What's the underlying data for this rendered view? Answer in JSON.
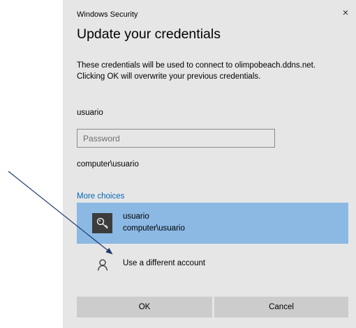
{
  "window": {
    "title": "Windows Security",
    "close_glyph": "×"
  },
  "heading": "Update your credentials",
  "description": "These credentials will be used to connect to olimpobeach.ddns.net. Clicking OK will overwrite your previous credentials.",
  "username_label": "usuario",
  "password": {
    "placeholder": "Password",
    "value": ""
  },
  "domain_user": "computer\\usuario",
  "more_choices_label": "More choices",
  "accounts": [
    {
      "name": "usuario",
      "domain": "computer\\usuario",
      "icon": "key-icon",
      "selected": true
    }
  ],
  "other_account_label": "Use a different account",
  "buttons": {
    "ok": "OK",
    "cancel": "Cancel"
  },
  "colors": {
    "dialog_bg": "#e6e6e6",
    "selected_bg": "#8bb9e4",
    "link": "#0067b8",
    "button_bg": "#cccccc",
    "arrow": "#1f3a6e"
  }
}
